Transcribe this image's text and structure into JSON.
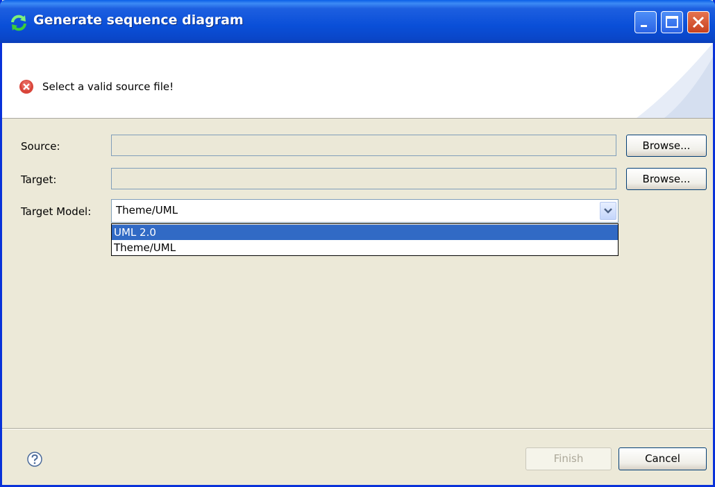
{
  "window": {
    "title": "Generate sequence diagram",
    "title_icon": "sync-arrows-icon",
    "controls": [
      "minimize-icon",
      "maximize-icon",
      "close-icon"
    ]
  },
  "banner": {
    "message": "Select a valid source file!",
    "message_icon": "error-icon"
  },
  "form": {
    "source_label": "Source:",
    "source_value": "",
    "target_label": "Target:",
    "target_value": "",
    "browse_label": "Browse...",
    "model_label": "Target Model:",
    "model_value": "Theme/UML",
    "model_options": [
      "UML 2.0",
      "Theme/UML"
    ],
    "highlighted_option": "UML 2.0"
  },
  "footer": {
    "help_icon": "help-icon",
    "finish_label": "Finish",
    "finish_enabled": false,
    "cancel_label": "Cancel"
  },
  "colors": {
    "titlebar": "#0a4fd8",
    "dialog_bg": "#ece9d8",
    "selection": "#316ac5",
    "error": "#d9453a"
  }
}
